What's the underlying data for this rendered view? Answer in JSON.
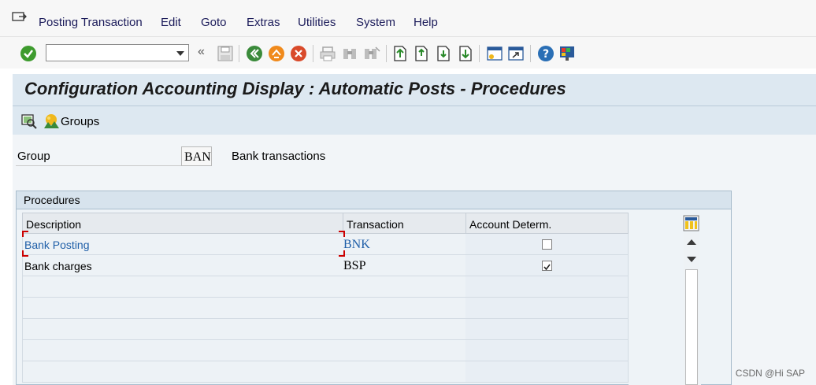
{
  "menubar": {
    "items": [
      "Posting Transaction",
      "Edit",
      "Goto",
      "Extras",
      "Utilities",
      "System",
      "Help"
    ]
  },
  "toolbar": {
    "command_field_value": "",
    "icons": [
      "enter-icon",
      "save-icon",
      "back-icon",
      "exit-icon",
      "cancel-icon",
      "print-icon",
      "find-icon",
      "find-next-icon",
      "first-page-icon",
      "previous-page-icon",
      "next-page-icon",
      "last-page-icon",
      "new-session-icon",
      "shortcut-icon",
      "help-icon",
      "customize-layout-icon"
    ]
  },
  "title": "Configuration Accounting Display : Automatic Posts - Procedures",
  "application_toolbar": {
    "groups_label": "Groups"
  },
  "group": {
    "label": "Group",
    "value": "BAN",
    "description": "Bank transactions"
  },
  "procedures": {
    "title": "Procedures",
    "columns": [
      "Description",
      "Transaction",
      "Account Determ."
    ],
    "rows": [
      {
        "description": "Bank Posting",
        "transaction": "BNK",
        "account_determ": false
      },
      {
        "description": "Bank charges",
        "transaction": "BSP",
        "account_determ": true
      }
    ]
  },
  "watermark": "CSDN @Hi SAP",
  "colors": {
    "title_bg": "#dde8f1",
    "link_blue": "#1f5fa8",
    "enter_green": "#3e9b2e",
    "back_green": "#3a8a3a",
    "exit_orange": "#f08a1c",
    "cancel_red": "#d94a2a"
  }
}
